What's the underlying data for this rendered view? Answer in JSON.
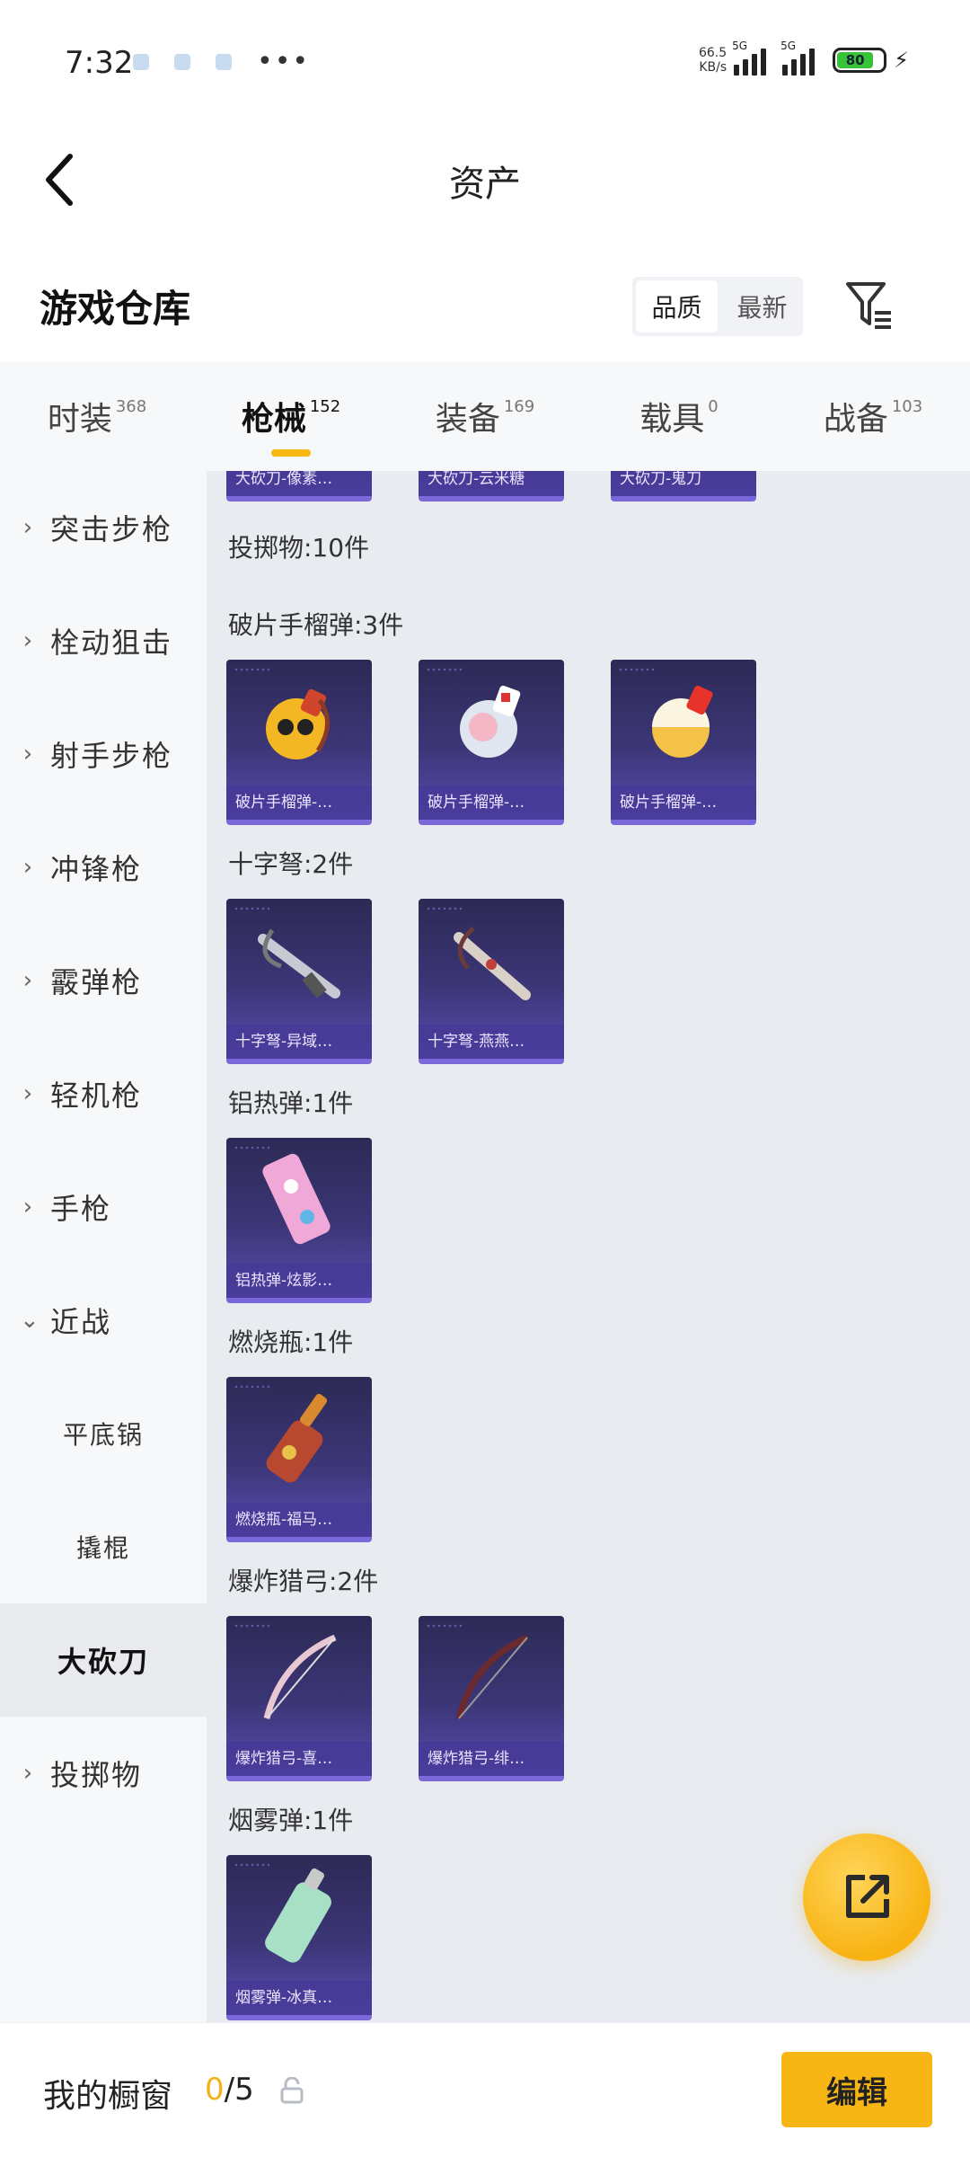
{
  "status_bar": {
    "time": "7:32",
    "more": "•••",
    "net_speed_value": "66.5",
    "net_speed_unit": "KB/s",
    "network_1": "5G",
    "network_2": "5G",
    "battery": "80"
  },
  "header": {
    "title": "资产"
  },
  "warehouse": {
    "title": "游戏仓库",
    "sort_options": [
      "品质",
      "最新"
    ]
  },
  "tabs": [
    {
      "label": "时装",
      "count": "368"
    },
    {
      "label": "枪械",
      "count": "152"
    },
    {
      "label": "装备",
      "count": "169"
    },
    {
      "label": "载具",
      "count": "0"
    },
    {
      "label": "战备",
      "count": "103"
    }
  ],
  "sidebar": {
    "items": [
      {
        "label": "突击步枪",
        "chevron": "›"
      },
      {
        "label": "栓动狙击",
        "chevron": "›"
      },
      {
        "label": "射手步枪",
        "chevron": "›"
      },
      {
        "label": "冲锋枪",
        "chevron": "›"
      },
      {
        "label": "霰弹枪",
        "chevron": "›"
      },
      {
        "label": "轻机枪",
        "chevron": "›"
      },
      {
        "label": "手枪",
        "chevron": "›"
      },
      {
        "label": "近战",
        "chevron": "⌄"
      },
      {
        "label": "平底锅"
      },
      {
        "label": "撬棍"
      },
      {
        "label": "大砍刀"
      },
      {
        "label": "投掷物",
        "chevron": "›"
      }
    ]
  },
  "content": {
    "top_cards": [
      "大砍刀-像素…",
      "大砍刀-云米糖",
      "大砍刀-鬼刀"
    ],
    "section_header": "投掷物:10件",
    "groups": [
      {
        "title": "破片手榴弹:3件",
        "items": [
          "破片手榴弹-…",
          "破片手榴弹-…",
          "破片手榴弹-…"
        ]
      },
      {
        "title": "十字弩:2件",
        "items": [
          "十字弩-异域…",
          "十字弩-燕燕…"
        ]
      },
      {
        "title": "铝热弹:1件",
        "items": [
          "铝热弹-炫影…"
        ]
      },
      {
        "title": "燃烧瓶:1件",
        "items": [
          "燃烧瓶-福马…"
        ]
      },
      {
        "title": "爆炸猎弓:2件",
        "items": [
          "爆炸猎弓-喜…",
          "爆炸猎弓-绯…"
        ]
      },
      {
        "title": "烟雾弹:1件",
        "items": [
          "烟雾弹-冰真…"
        ]
      }
    ]
  },
  "bottom_bar": {
    "showcase_label": "我的橱窗",
    "showcase_current": "0",
    "showcase_total": "/5",
    "edit_label": "编辑"
  },
  "colors": {
    "accent": "#f7b613",
    "card_top": "#2c2a55",
    "card_bottom": "#5b4bb0",
    "content_bg": "#e8ebf0"
  }
}
